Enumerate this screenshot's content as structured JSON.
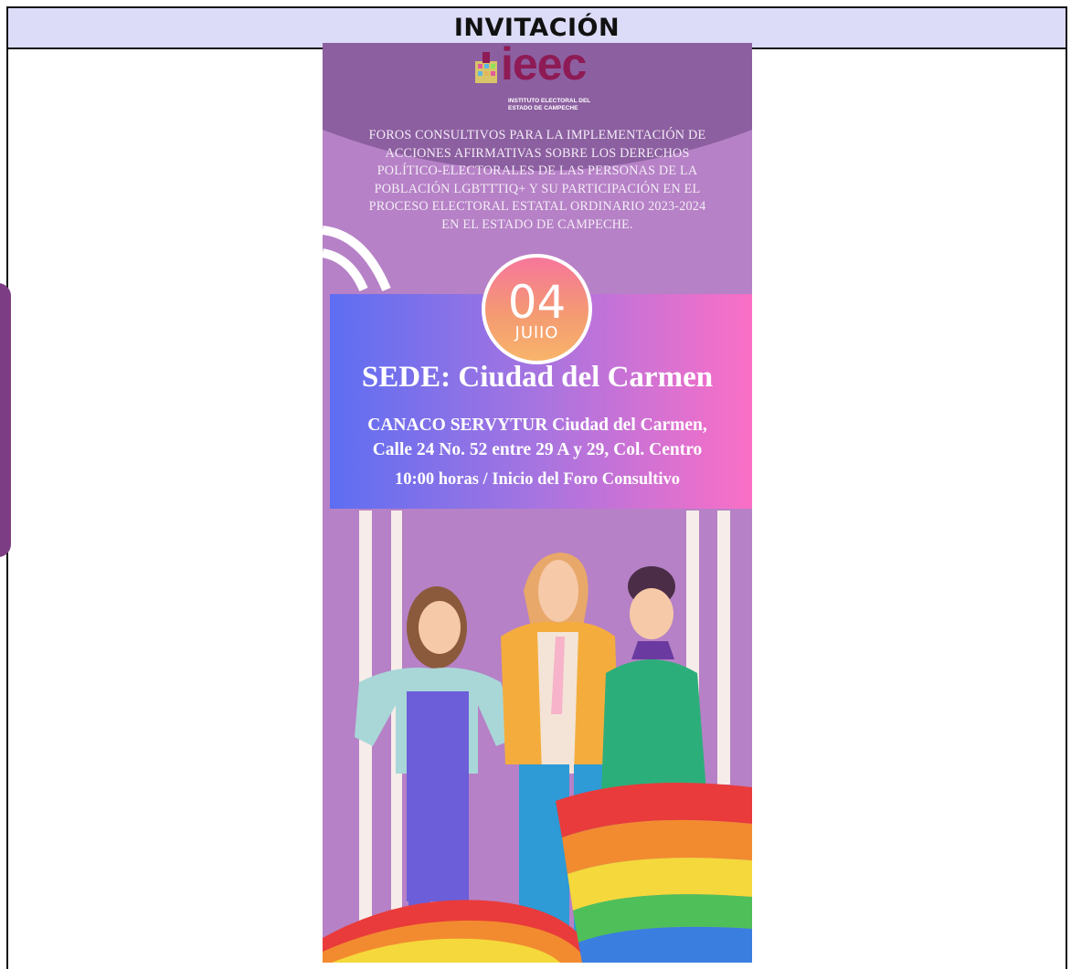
{
  "document": {
    "header_title": "INVITACIÓN"
  },
  "poster": {
    "logo": {
      "name": "ieec",
      "subtitle": "INSTITUTO ELECTORAL DEL ESTADO DE CAMPECHE",
      "brand_color": "#8e1b55"
    },
    "forum_title_lines": [
      "FOROS CONSULTIVOS PARA LA IMPLEMENTACIÓN DE",
      "ACCIONES AFIRMATIVAS SOBRE LOS DERECHOS",
      "POLÍTICO-ELECTORALES DE LAS PERSONAS DE LA",
      "POBLACIÓN LGBTTTIQ+ Y SU PARTICIPACIÓN EN EL",
      "PROCESO ELECTORAL ESTATAL ORDINARIO 2023-2024",
      "EN EL ESTADO DE CAMPECHE."
    ],
    "date": {
      "day": "04",
      "month": "JUlIO"
    },
    "venue": {
      "title": "SEDE: Ciudad del Carmen",
      "address_line1": "CANACO SERVYTUR Ciudad del Carmen,",
      "address_line2": "Calle 24 No. 52 entre 29 A y 29, Col. Centro",
      "time": "10:00 horas / Inicio del Foro Consultivo"
    },
    "colors": {
      "background": "#b681c6",
      "band_left": "#5d6ef2",
      "band_right": "#fb6fc6",
      "top_arc": "#8c5fa0"
    }
  }
}
